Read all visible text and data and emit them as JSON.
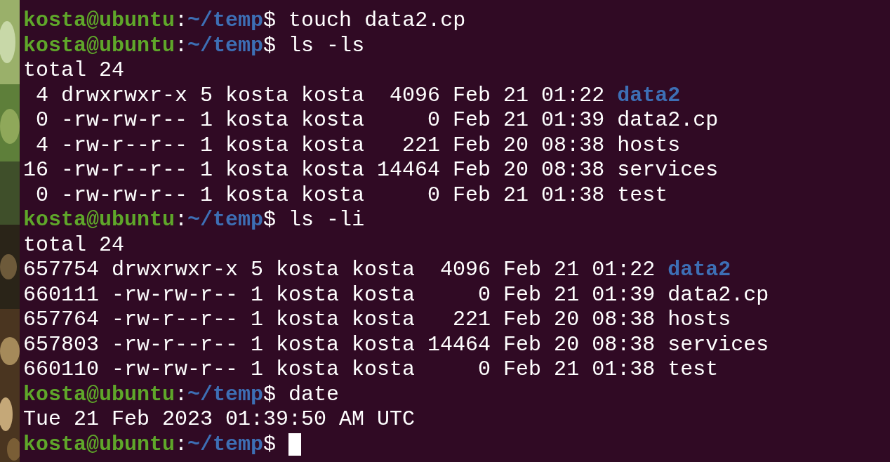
{
  "terminal": {
    "lines": [
      {
        "kind": "prompt",
        "user": "kosta@ubuntu",
        "sep": ":",
        "path": "~/temp",
        "symbol": "$",
        "command": " touch data2.cp"
      },
      {
        "kind": "prompt",
        "user": "kosta@ubuntu",
        "sep": ":",
        "path": "~/temp",
        "symbol": "$",
        "command": " ls -ls"
      },
      {
        "kind": "output",
        "text": "total 24"
      },
      {
        "kind": "entry",
        "prefix": " 4 drwxrwxr-x 5 kosta kosta  4096 Feb 21 01:22 ",
        "name": "data2",
        "directory": true
      },
      {
        "kind": "entry",
        "prefix": " 0 -rw-rw-r-- 1 kosta kosta     0 Feb 21 01:39 ",
        "name": "data2.cp",
        "directory": false
      },
      {
        "kind": "entry",
        "prefix": " 4 -rw-r--r-- 1 kosta kosta   221 Feb 20 08:38 ",
        "name": "hosts",
        "directory": false
      },
      {
        "kind": "entry",
        "prefix": "16 -rw-r--r-- 1 kosta kosta 14464 Feb 20 08:38 ",
        "name": "services",
        "directory": false
      },
      {
        "kind": "entry",
        "prefix": " 0 -rw-rw-r-- 1 kosta kosta     0 Feb 21 01:38 ",
        "name": "test",
        "directory": false
      },
      {
        "kind": "prompt",
        "user": "kosta@ubuntu",
        "sep": ":",
        "path": "~/temp",
        "symbol": "$",
        "command": " ls -li"
      },
      {
        "kind": "output",
        "text": "total 24"
      },
      {
        "kind": "entry",
        "prefix": "657754 drwxrwxr-x 5 kosta kosta  4096 Feb 21 01:22 ",
        "name": "data2",
        "directory": true
      },
      {
        "kind": "entry",
        "prefix": "660111 -rw-rw-r-- 1 kosta kosta     0 Feb 21 01:39 ",
        "name": "data2.cp",
        "directory": false
      },
      {
        "kind": "entry",
        "prefix": "657764 -rw-r--r-- 1 kosta kosta   221 Feb 20 08:38 ",
        "name": "hosts",
        "directory": false
      },
      {
        "kind": "entry",
        "prefix": "657803 -rw-r--r-- 1 kosta kosta 14464 Feb 20 08:38 ",
        "name": "services",
        "directory": false
      },
      {
        "kind": "entry",
        "prefix": "660110 -rw-rw-r-- 1 kosta kosta     0 Feb 21 01:38 ",
        "name": "test",
        "directory": false
      },
      {
        "kind": "prompt",
        "user": "kosta@ubuntu",
        "sep": ":",
        "path": "~/temp",
        "symbol": "$",
        "command": " date"
      },
      {
        "kind": "output",
        "text": "Tue 21 Feb 2023 01:39:50 AM UTC"
      },
      {
        "kind": "prompt",
        "user": "kosta@ubuntu",
        "sep": ":",
        "path": "~/temp",
        "symbol": "$",
        "cursor": true
      }
    ]
  }
}
